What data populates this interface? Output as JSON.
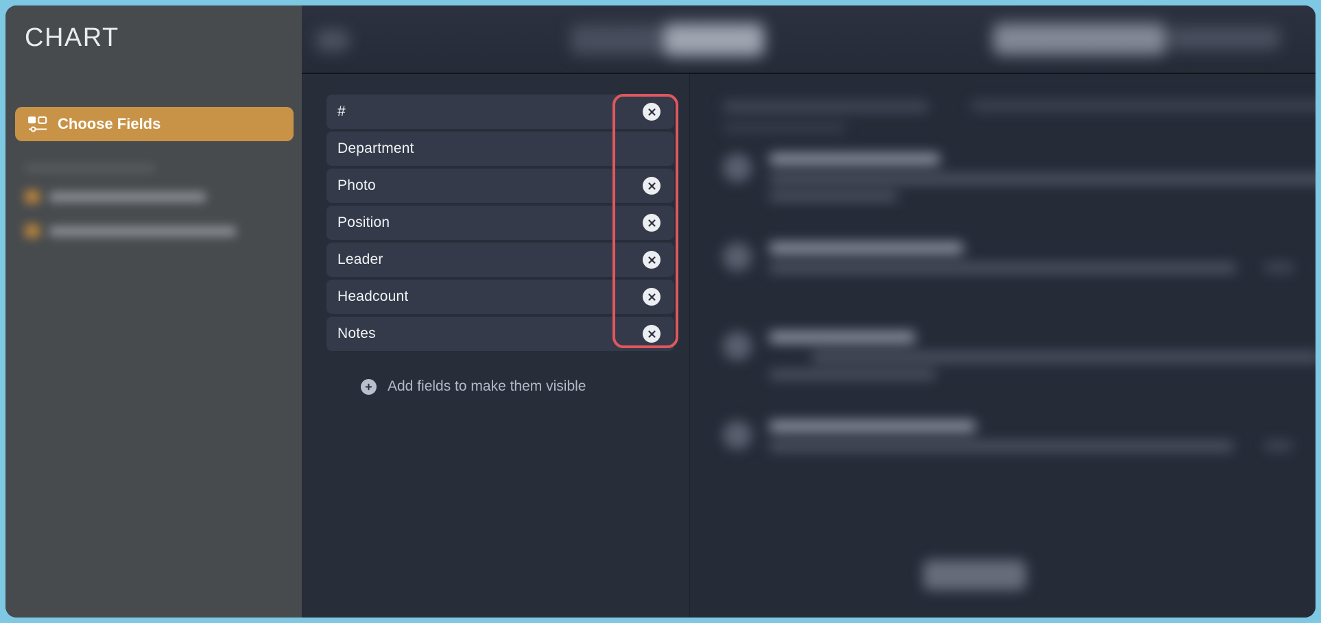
{
  "window": {
    "accent_border_color": "#7ec8e3",
    "background_color": "#262b38"
  },
  "sidebar": {
    "title": "CHART",
    "active_button": {
      "label": "Choose Fields",
      "icon": "fields-layout-icon",
      "color": "#c99347"
    },
    "blurred_section_present": true
  },
  "topbar": {
    "blurred": true
  },
  "fields_panel": {
    "fields": [
      {
        "label": "#",
        "removable": true
      },
      {
        "label": "Department",
        "removable": false
      },
      {
        "label": "Photo",
        "removable": true
      },
      {
        "label": "Position",
        "removable": true
      },
      {
        "label": "Leader",
        "removable": true
      },
      {
        "label": "Headcount",
        "removable": true
      },
      {
        "label": "Notes",
        "removable": true
      }
    ],
    "remove_icon": "close-circle-icon",
    "add_fields": {
      "label": "Add fields to make them visible",
      "icon": "plus-circle-icon"
    },
    "highlight": {
      "color": "#e0575f",
      "target": "remove-button-column"
    }
  },
  "preview_panel": {
    "blurred": true,
    "item_count": 4
  }
}
